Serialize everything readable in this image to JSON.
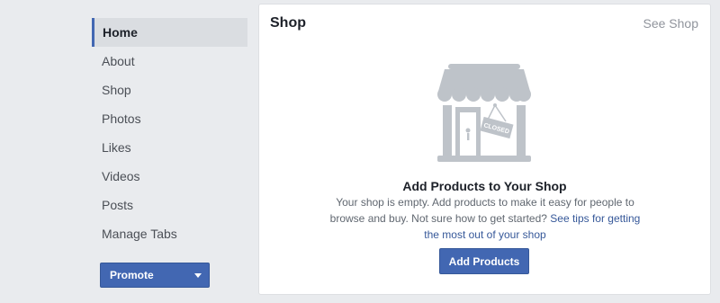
{
  "sidebar": {
    "items": [
      {
        "label": "Home",
        "active": true
      },
      {
        "label": "About"
      },
      {
        "label": "Shop"
      },
      {
        "label": "Photos"
      },
      {
        "label": "Likes"
      },
      {
        "label": "Videos"
      },
      {
        "label": "Posts"
      },
      {
        "label": "Manage Tabs"
      }
    ],
    "promote_label": "Promote"
  },
  "shop_card": {
    "title": "Shop",
    "see_link": "See Shop",
    "sign_text": "CLOSED",
    "empty_title": "Add Products to Your Shop",
    "empty_desc": "Your shop is empty. Add products to make it easy for people to browse and buy. Not sure how to get started?",
    "tips_link": "See tips for getting the most out of your shop",
    "add_button": "Add Products"
  },
  "colors": {
    "page_bg": "#e9ebee",
    "brand": "#4267b2",
    "link": "#365899",
    "illustration": "#bec3c9"
  }
}
